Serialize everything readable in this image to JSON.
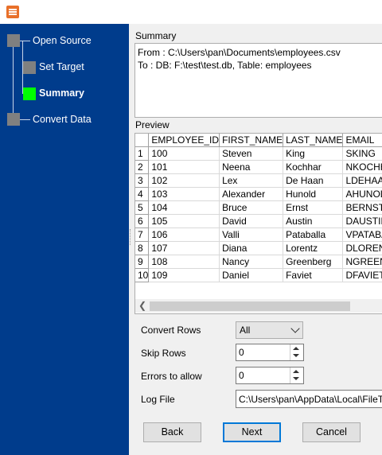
{
  "wizard_steps": [
    {
      "label": "Open Source",
      "state": "done"
    },
    {
      "label": "Set Target",
      "state": "done"
    },
    {
      "label": "Summary",
      "state": "current"
    },
    {
      "label": "Convert Data",
      "state": "pending"
    }
  ],
  "summary": {
    "title": "Summary",
    "from_line": "From : C:\\Users\\pan\\Documents\\employees.csv",
    "to_line": "To : DB: F:\\test\\test.db, Table: employees"
  },
  "preview": {
    "title": "Preview",
    "columns": [
      "EMPLOYEE_ID",
      "FIRST_NAME",
      "LAST_NAME",
      "EMAIL"
    ],
    "rows": [
      [
        "1",
        "100",
        "Steven",
        "King",
        "SKING"
      ],
      [
        "2",
        "101",
        "Neena",
        "Kochhar",
        "NKOCHHAR"
      ],
      [
        "3",
        "102",
        "Lex",
        "De Haan",
        "LDEHAAN"
      ],
      [
        "4",
        "103",
        "Alexander",
        "Hunold",
        "AHUNOLD"
      ],
      [
        "5",
        "104",
        "Bruce",
        "Ernst",
        "BERNST"
      ],
      [
        "6",
        "105",
        "David",
        "Austin",
        "DAUSTIN"
      ],
      [
        "7",
        "106",
        "Valli",
        "Pataballa",
        "VPATABAL"
      ],
      [
        "8",
        "107",
        "Diana",
        "Lorentz",
        "DLORENTZ"
      ],
      [
        "9",
        "108",
        "Nancy",
        "Greenberg",
        "NGREENBE"
      ],
      [
        "10",
        "109",
        "Daniel",
        "Faviet",
        "DFAVIET"
      ]
    ]
  },
  "options": {
    "convert_rows_label": "Convert Rows",
    "convert_rows_value": "All",
    "skip_rows_label": "Skip Rows",
    "skip_rows_value": "0",
    "errors_label": "Errors to allow",
    "errors_value": "0",
    "log_file_label": "Log File",
    "log_file_value": "C:\\Users\\pan\\AppData\\Local\\FileToDB\\log.txt"
  },
  "buttons": {
    "back": "Back",
    "next": "Next",
    "cancel": "Cancel"
  },
  "colors": {
    "sidebar_bg": "#003c8c",
    "current_step": "#00ff00",
    "other_step": "#808080"
  }
}
